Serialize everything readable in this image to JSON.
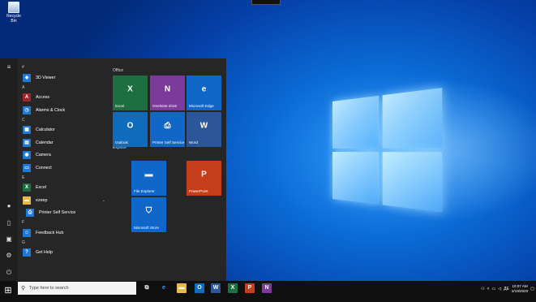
{
  "desktop": {
    "recycle_bin_label": "Recycle Bin"
  },
  "start_menu": {
    "rail": [
      "hamburger-icon",
      "user-icon",
      "document-icon",
      "pictures-icon",
      "settings-icon",
      "power-icon"
    ],
    "app_groups": [
      {
        "letter": "#",
        "apps": [
          {
            "name": "3D Viewer",
            "icon": "cube-icon",
            "color": "#1e79d6",
            "glyph": "◈"
          }
        ]
      },
      {
        "letter": "A",
        "apps": [
          {
            "name": "Access",
            "icon": "access-icon",
            "color": "#a4262c",
            "glyph": "A"
          },
          {
            "name": "Alarms & Clock",
            "icon": "alarm-clock-icon",
            "color": "#1e79d6",
            "glyph": "◷"
          }
        ]
      },
      {
        "letter": "C",
        "apps": [
          {
            "name": "Calculator",
            "icon": "calculator-icon",
            "color": "#1e79d6",
            "glyph": "▦"
          },
          {
            "name": "Calendar",
            "icon": "calendar-icon",
            "color": "#1e79d6",
            "glyph": "▤"
          },
          {
            "name": "Camera",
            "icon": "camera-icon",
            "color": "#1e79d6",
            "glyph": "◉"
          },
          {
            "name": "Connect",
            "icon": "connect-icon",
            "color": "#1e79d6",
            "glyph": "▭"
          }
        ]
      },
      {
        "letter": "E",
        "apps": [
          {
            "name": "Excel",
            "icon": "excel-icon",
            "color": "#1d6f42",
            "glyph": "X"
          },
          {
            "name": "ezeep",
            "icon": "folder-icon",
            "color": "#e8b84a",
            "glyph": "▬",
            "expandable": true
          },
          {
            "name": "Printer Self Service",
            "icon": "printer-icon",
            "color": "#1e79d6",
            "glyph": "⎙",
            "sub": true
          }
        ]
      },
      {
        "letter": "F",
        "apps": [
          {
            "name": "Feedback Hub",
            "icon": "feedback-icon",
            "color": "#1e79d6",
            "glyph": "☺"
          }
        ]
      },
      {
        "letter": "G",
        "apps": [
          {
            "name": "Get Help",
            "icon": "help-icon",
            "color": "#1e79d6",
            "glyph": "?"
          }
        ]
      }
    ],
    "tile_groups": {
      "office": "Office",
      "explore": "Explore"
    },
    "tiles": [
      {
        "label": "Excel",
        "icon": "excel-icon",
        "color": "#1d6f42",
        "glyph": "X"
      },
      {
        "label": "OneNote 2016",
        "icon": "onenote-icon",
        "color": "#7c3a9a",
        "glyph": "N"
      },
      {
        "label": "Microsoft Edge",
        "icon": "edge-icon",
        "color": "#1167c8",
        "glyph": "e"
      },
      {
        "label": "Outlook",
        "icon": "outlook-icon",
        "color": "#0f6cbd",
        "glyph": "O"
      },
      {
        "label": "Printer Self Service",
        "icon": "printer-icon",
        "color": "#1167c8",
        "glyph": "⎙"
      },
      {
        "label": "Word",
        "icon": "word-icon",
        "color": "#2b579a",
        "glyph": "W"
      },
      {
        "label": "File Explorer",
        "icon": "folder-icon",
        "color": "#1167c8",
        "glyph": "▬"
      },
      {
        "label": "PowerPoint",
        "icon": "powerpoint-icon",
        "color": "#c43e1c",
        "glyph": "P"
      },
      {
        "label": "Microsoft Store",
        "icon": "store-icon",
        "color": "#1167c8",
        "glyph": "⛉"
      }
    ]
  },
  "taskbar": {
    "search_placeholder": "Type here to search",
    "pinned": [
      {
        "icon": "task-view-icon",
        "color": "#101010",
        "glyph": "⧉"
      },
      {
        "icon": "edge-icon",
        "color": "#101010",
        "glyph": "e"
      },
      {
        "icon": "file-explorer-icon",
        "color": "#e8b84a",
        "glyph": "▬"
      },
      {
        "icon": "outlook-icon",
        "color": "#0f6cbd",
        "glyph": "O"
      },
      {
        "icon": "word-icon",
        "color": "#2b579a",
        "glyph": "W"
      },
      {
        "icon": "excel-icon",
        "color": "#1d6f42",
        "glyph": "X"
      },
      {
        "icon": "powerpoint-icon",
        "color": "#c43e1c",
        "glyph": "P"
      },
      {
        "icon": "onenote-icon",
        "color": "#7c3a9a",
        "glyph": "N"
      }
    ],
    "tray": {
      "language": "ДЕ",
      "time": "10:07 AM",
      "date": "2/19/2020"
    }
  }
}
